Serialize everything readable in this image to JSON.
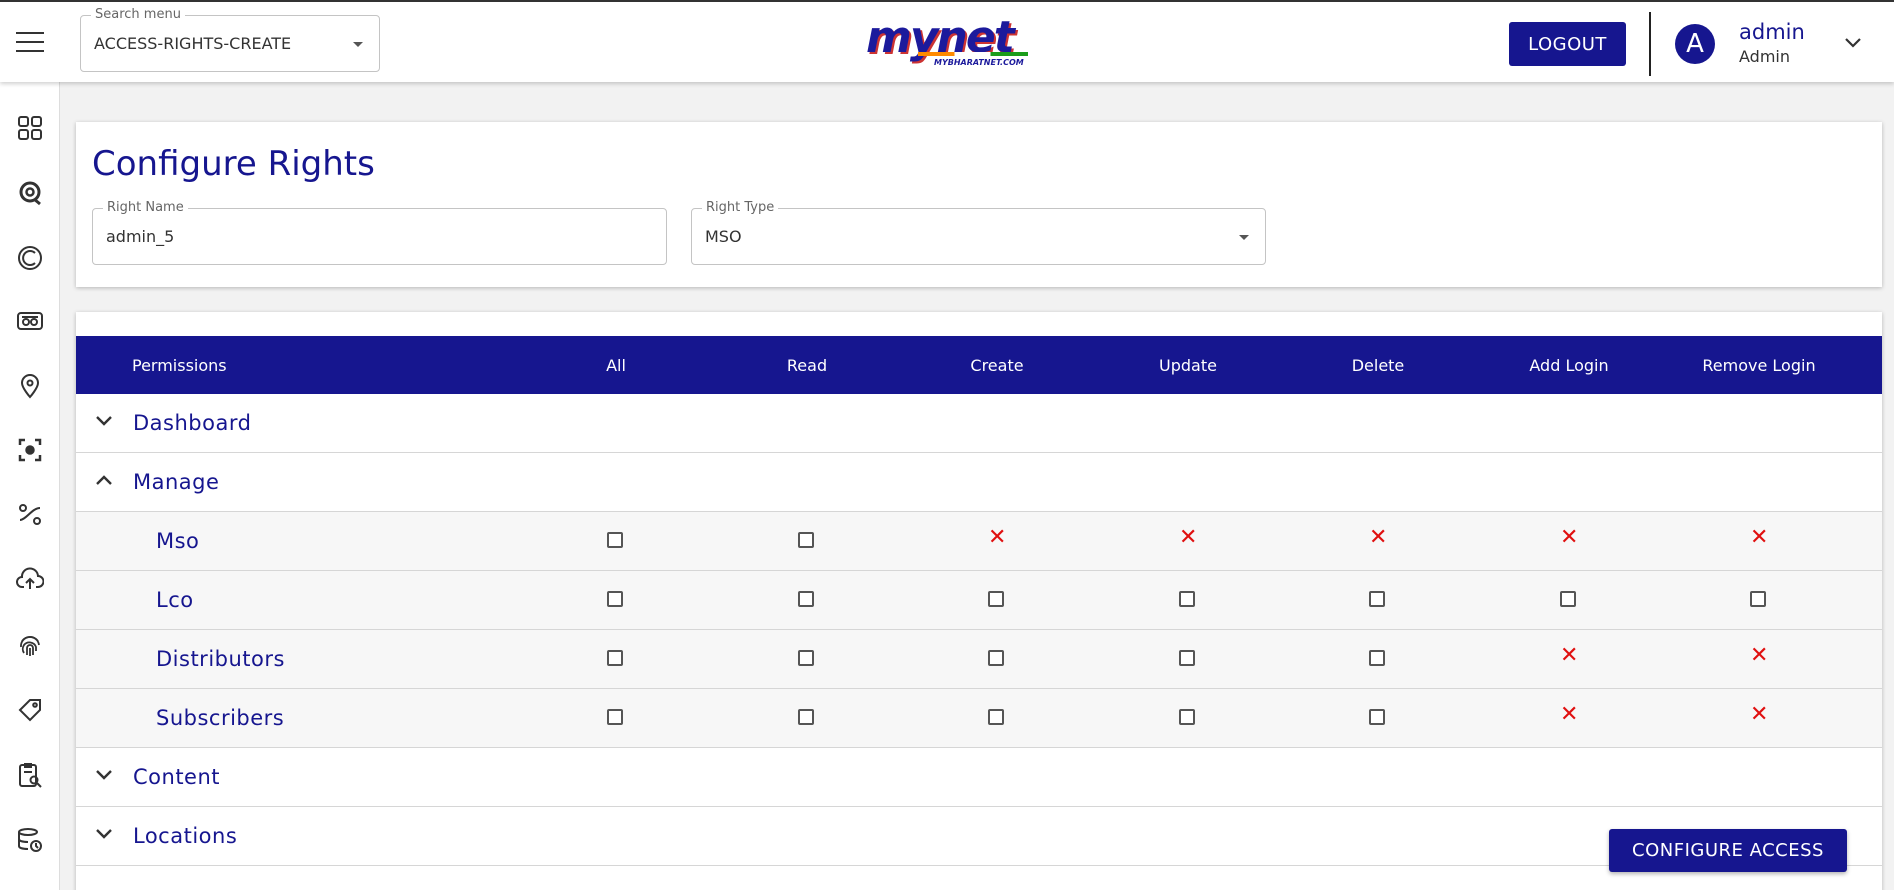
{
  "header": {
    "search_menu": {
      "legend": "Search menu",
      "value": "ACCESS-RIGHTS-CREATE"
    },
    "logo": {
      "word": "mynet",
      "sub": "MYBHARATNET.COM"
    },
    "logout_label": "LOGOUT",
    "user": {
      "initial": "A",
      "name": "admin",
      "role": "Admin"
    }
  },
  "sidebar": {
    "icons": [
      "dashboard-icon",
      "support-icon",
      "copyright-icon",
      "router-icon",
      "location-icon",
      "scan-icon",
      "percent-icon",
      "cloud-upload-icon",
      "fingerprint-icon",
      "ticket-icon",
      "report-search-icon",
      "database-history-icon"
    ]
  },
  "configure": {
    "title": "Configure Rights",
    "right_name": {
      "legend": "Right Name",
      "value": "admin_5"
    },
    "right_type": {
      "legend": "Right Type",
      "value": "MSO"
    }
  },
  "permissions": {
    "columns": [
      "Permissions",
      "All",
      "Read",
      "Create",
      "Update",
      "Delete",
      "Add Login",
      "Remove Login"
    ],
    "groups": [
      {
        "label": "Dashboard",
        "expanded": false
      },
      {
        "label": "Manage",
        "expanded": true,
        "items": [
          {
            "label": "Mso",
            "cells": [
              "box",
              "box",
              "x",
              "x",
              "x",
              "x",
              "x"
            ]
          },
          {
            "label": "Lco",
            "cells": [
              "box",
              "box",
              "box",
              "box",
              "box",
              "box",
              "box"
            ]
          },
          {
            "label": "Distributors",
            "cells": [
              "box",
              "box",
              "box",
              "box",
              "box",
              "x",
              "x"
            ]
          },
          {
            "label": "Subscribers",
            "cells": [
              "box",
              "box",
              "box",
              "box",
              "box",
              "x",
              "x"
            ]
          }
        ]
      },
      {
        "label": "Content",
        "expanded": false
      },
      {
        "label": "Locations",
        "expanded": false
      }
    ]
  },
  "configure_access_label": "CONFIGURE ACCESS",
  "colors": {
    "primary": "#16168f",
    "deny": "#e01010"
  }
}
